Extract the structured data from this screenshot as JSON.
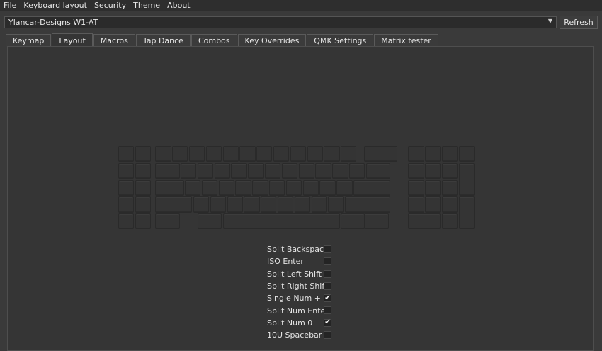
{
  "menubar": {
    "items": [
      "File",
      "Keyboard layout",
      "Security",
      "Theme",
      "About"
    ]
  },
  "device": {
    "selected": "Ylancar-Designs W1-AT",
    "refresh_label": "Refresh"
  },
  "tabs": [
    {
      "label": "Keymap",
      "active": false
    },
    {
      "label": "Layout",
      "active": true
    },
    {
      "label": "Macros",
      "active": false
    },
    {
      "label": "Tap Dance",
      "active": false
    },
    {
      "label": "Combos",
      "active": false
    },
    {
      "label": "Key Overrides",
      "active": false
    },
    {
      "label": "QMK Settings",
      "active": false
    },
    {
      "label": "Matrix tester",
      "active": false
    }
  ],
  "layout_options": [
    {
      "label": "Split Backspace",
      "checked": false
    },
    {
      "label": "ISO Enter",
      "checked": false
    },
    {
      "label": "Split Left Shift",
      "checked": false
    },
    {
      "label": "Split Right Shift",
      "checked": false
    },
    {
      "label": "Single Num +",
      "checked": true
    },
    {
      "label": "Split Num Enter",
      "checked": false
    },
    {
      "label": "Split Num 0",
      "checked": true
    },
    {
      "label": "10U Spacebar",
      "checked": false
    }
  ],
  "icons": {
    "dropdown": "chevron-down-icon",
    "checkmark": "checkmark-icon"
  }
}
